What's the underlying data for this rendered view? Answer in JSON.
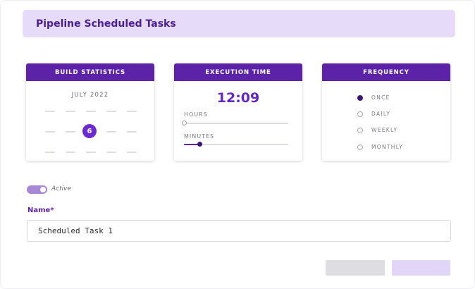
{
  "header": {
    "title": "Pipeline Scheduled Tasks"
  },
  "build_statistics": {
    "title": "BUILD STATISTICS",
    "month": "JULY 2022",
    "selected_day": "6"
  },
  "execution_time": {
    "title": "EXECUTION TIME",
    "time": "12:09",
    "hours_label": "HOURS",
    "minutes_label": "MINUTES",
    "hours_fraction": 0.0,
    "minutes_fraction": 0.15
  },
  "frequency": {
    "title": "FREQUENCY",
    "options": [
      {
        "label": "ONCE",
        "selected": true
      },
      {
        "label": "DAILY",
        "selected": false
      },
      {
        "label": "WEEKLY",
        "selected": false
      },
      {
        "label": "MONTHLY",
        "selected": false
      }
    ]
  },
  "toggle": {
    "label": "Active",
    "on": true
  },
  "name_field": {
    "label": "Name*",
    "value": "Scheduled Task 1"
  },
  "colors": {
    "accent": "#5c23a8",
    "header_bg": "#e6dcfa",
    "selected_day": "#6a2bd0",
    "time_text": "#6326c9"
  }
}
